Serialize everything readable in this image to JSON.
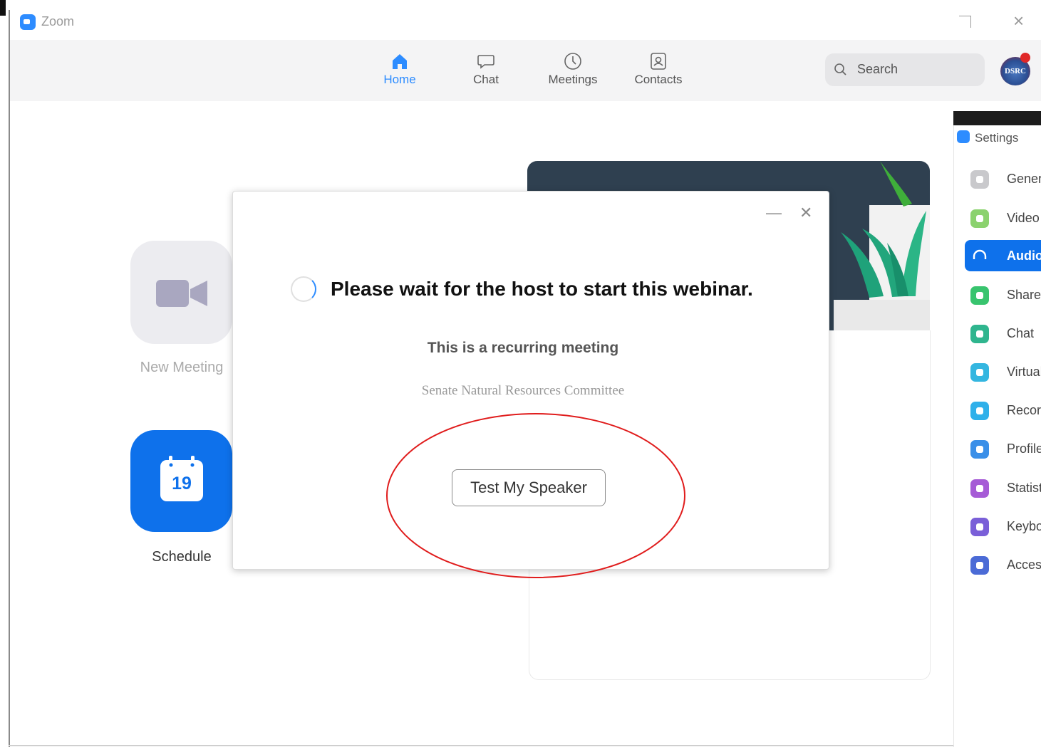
{
  "window": {
    "title": "Zoom"
  },
  "nav": [
    {
      "id": "home",
      "label": "Home",
      "icon": "home-icon",
      "active": true
    },
    {
      "id": "chat",
      "label": "Chat",
      "icon": "chat-bubble-icon",
      "active": false
    },
    {
      "id": "meetings",
      "label": "Meetings",
      "icon": "clock-icon",
      "active": false
    },
    {
      "id": "contacts",
      "label": "Contacts",
      "icon": "contact-card-icon",
      "active": false
    }
  ],
  "search": {
    "placeholder": "Search"
  },
  "profile": {
    "avatar_text": "DSRC"
  },
  "home_actions": {
    "new_meeting": "New Meeting",
    "schedule": "Schedule",
    "calendar_day": "19"
  },
  "settings": {
    "title": "Settings",
    "items": [
      {
        "label": "General",
        "color": "#c9c9cc",
        "icon": "gear-icon"
      },
      {
        "label": "Video",
        "color": "#8bd26e",
        "icon": "video-camera-icon"
      },
      {
        "label": "Audio",
        "color": "#ffffff",
        "icon": "headphones-icon",
        "active": true
      },
      {
        "label": "Share Screen",
        "color": "#38c46e",
        "icon": "share-screen-icon"
      },
      {
        "label": "Chat",
        "color": "#2fb58e",
        "icon": "chat-icon"
      },
      {
        "label": "Virtual Background",
        "color": "#34b6e0",
        "icon": "virtual-background-icon"
      },
      {
        "label": "Recording",
        "color": "#2fb0ea",
        "icon": "record-icon"
      },
      {
        "label": "Profile",
        "color": "#3a8fe8",
        "icon": "profile-icon"
      },
      {
        "label": "Statistics",
        "color": "#a65bd6",
        "icon": "statistics-icon"
      },
      {
        "label": "Keyboard Shortcuts",
        "color": "#7a5fd8",
        "icon": "keyboard-icon"
      },
      {
        "label": "Accessibility",
        "color": "#4b6bd6",
        "icon": "accessibility-icon"
      }
    ]
  },
  "dialog": {
    "message": "Please wait for the host to start this webinar.",
    "recurring": "This is a recurring meeting",
    "topic": "Senate Natural Resources Committee",
    "button": "Test My Speaker"
  },
  "colors": {
    "accent": "#2d8cff",
    "annotation": "#e01c1c"
  }
}
